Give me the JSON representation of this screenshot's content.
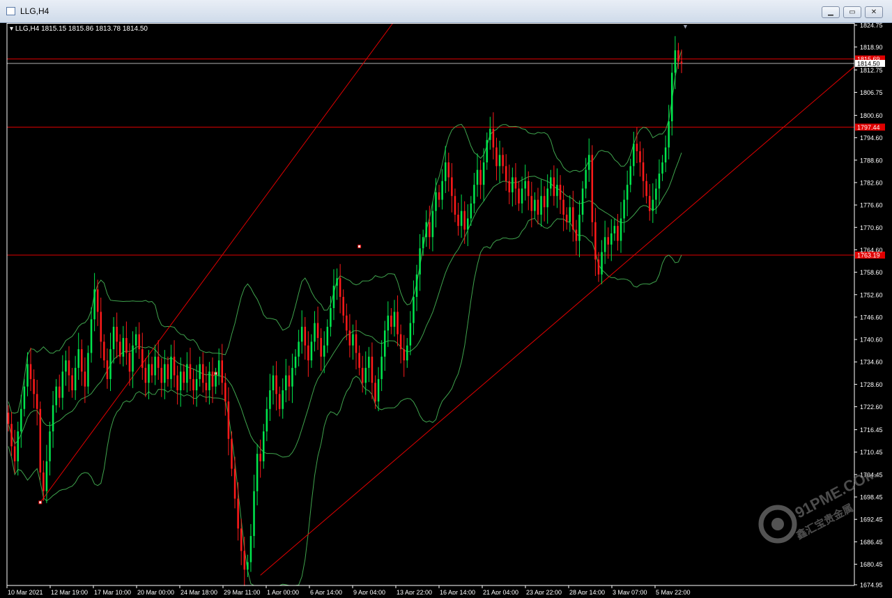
{
  "window": {
    "title": "LLG,H4",
    "buttons": [
      "minimize",
      "restore",
      "close"
    ]
  },
  "header": {
    "symbol": "LLG,H4",
    "ohlc": "1815.15 1815.86 1813.78 1814.50"
  },
  "watermark": {
    "brand": "91PME.COM",
    "sub": "鑫汇宝贵金属"
  },
  "colors": {
    "bull": "#00e64d",
    "bear": "#ff1a1a",
    "band": "#3fa34d",
    "level": "#e00000",
    "bid": "#b0b0b0",
    "grid_text": "#ffffff"
  },
  "chart_data": {
    "type": "candlestick",
    "title": "LLG,H4",
    "ylim": [
      1674.95,
      1824.75
    ],
    "y_ticks": [
      "1824.75",
      "1818.90",
      "1812.75",
      "1806.75",
      "1800.60",
      "1794.60",
      "1788.60",
      "1782.60",
      "1776.60",
      "1770.60",
      "1764.60",
      "1758.60",
      "1752.60",
      "1746.60",
      "1740.60",
      "1734.60",
      "1728.60",
      "1722.60",
      "1716.45",
      "1710.45",
      "1704.45",
      "1698.45",
      "1692.45",
      "1686.45",
      "1680.45",
      "1674.95"
    ],
    "x_ticks": [
      "10 Mar 2021",
      "12 Mar 19:00",
      "17 Mar 10:00",
      "20 Mar 00:00",
      "24 Mar 18:00",
      "29 Mar 11:00",
      "1 Apr 00:00",
      "6 Apr 14:00",
      "9 Apr 04:00",
      "13 Apr 22:00",
      "16 Apr 14:00",
      "21 Apr 04:00",
      "23 Apr 22:00",
      "28 Apr 14:00",
      "3 May 07:00",
      "5 May 22:00"
    ],
    "price_labels": [
      {
        "value": 1815.69,
        "text": "1815.69",
        "kind": "level"
      },
      {
        "value": 1814.5,
        "text": "1814.50",
        "kind": "bid"
      },
      {
        "value": 1797.44,
        "text": "1797.44",
        "kind": "level"
      },
      {
        "value": 1763.19,
        "text": "1763.19",
        "kind": "level"
      }
    ],
    "channel": {
      "lower_start": {
        "bar": 79,
        "price": 1677.5
      },
      "lower_end": {
        "bar": 267,
        "price": 1815.0
      },
      "upper_start": {
        "bar": 10,
        "price": 1697.0
      },
      "upper_end": {
        "bar": 122,
        "price": 1827.0
      }
    },
    "anchors": [
      {
        "bar": 10,
        "price": 1697.0
      },
      {
        "bar": 65,
        "price": 1731.5
      },
      {
        "bar": 110,
        "price": 1765.5
      }
    ],
    "closes": [
      1718,
      1712,
      1708,
      1716,
      1722,
      1728,
      1734,
      1730,
      1726,
      1722,
      1705,
      1700,
      1708,
      1716,
      1723,
      1728,
      1725,
      1732,
      1735,
      1731,
      1727,
      1733,
      1738,
      1732,
      1728,
      1737,
      1746,
      1754,
      1748,
      1740,
      1735,
      1730,
      1738,
      1744,
      1740,
      1736,
      1741,
      1737,
      1732,
      1739,
      1742,
      1738,
      1733,
      1729,
      1734,
      1731,
      1736,
      1733,
      1729,
      1734,
      1730,
      1736,
      1731,
      1727,
      1732,
      1729,
      1734,
      1730,
      1727,
      1730,
      1734,
      1729,
      1727,
      1732,
      1728,
      1731,
      1735,
      1729,
      1724,
      1714,
      1706,
      1698,
      1690,
      1684,
      1679,
      1681,
      1688,
      1700,
      1710,
      1708,
      1716,
      1722,
      1727,
      1731,
      1726,
      1722,
      1727,
      1731,
      1728,
      1733,
      1736,
      1740,
      1744,
      1739,
      1735,
      1740,
      1745,
      1741,
      1736,
      1739,
      1744,
      1749,
      1755,
      1757,
      1752,
      1747,
      1743,
      1739,
      1742,
      1737,
      1733,
      1729,
      1733,
      1736,
      1729,
      1724,
      1730,
      1736,
      1743,
      1747,
      1744,
      1748,
      1742,
      1738,
      1735,
      1739,
      1745,
      1752,
      1758,
      1765,
      1768,
      1772,
      1768,
      1775,
      1780,
      1778,
      1783,
      1788,
      1784,
      1779,
      1774,
      1771,
      1775,
      1770,
      1773,
      1777,
      1782,
      1786,
      1782,
      1788,
      1794,
      1797,
      1792,
      1787,
      1790,
      1787,
      1783,
      1780,
      1784,
      1781,
      1777,
      1781,
      1783,
      1779,
      1775,
      1778,
      1774,
      1779,
      1776,
      1781,
      1784,
      1779,
      1782,
      1778,
      1774,
      1772,
      1776,
      1770,
      1767,
      1774,
      1781,
      1786,
      1790,
      1772,
      1762,
      1758,
      1764,
      1768,
      1766,
      1769,
      1771,
      1767,
      1773,
      1778,
      1782,
      1787,
      1793,
      1791,
      1788,
      1783,
      1779,
      1775,
      1778,
      1781,
      1785,
      1788,
      1792,
      1799,
      1812,
      1818,
      1815,
      1814.5
    ]
  }
}
